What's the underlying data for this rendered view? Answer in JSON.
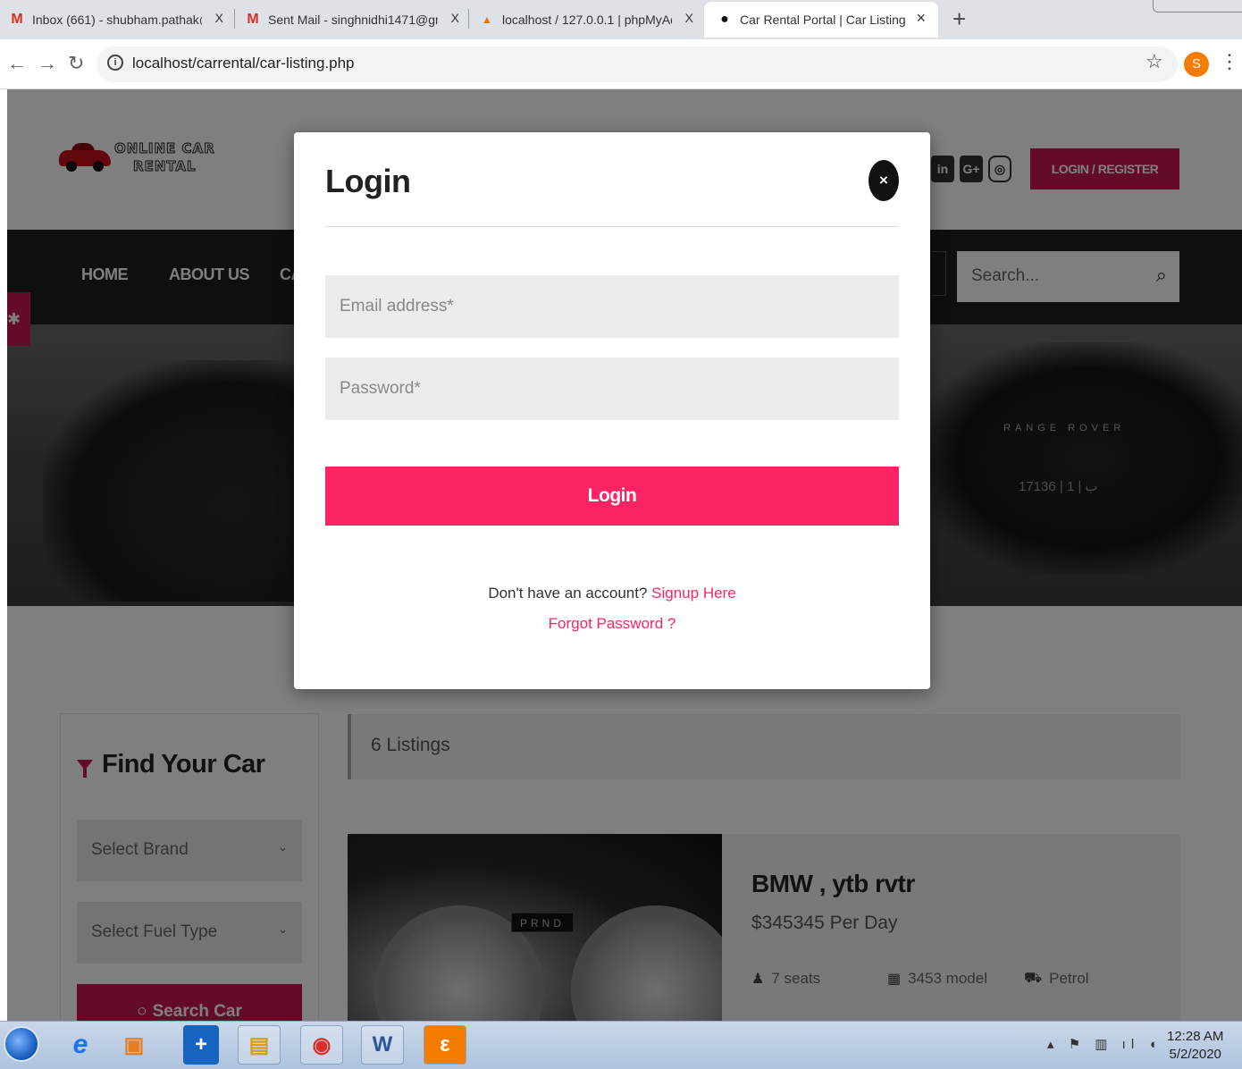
{
  "browser": {
    "tabs": [
      {
        "icon": "gmail-icon",
        "title": "Inbox (661) - shubham.pathak@t"
      },
      {
        "icon": "gmail-icon",
        "title": "Sent Mail - singhnidhi1471@gm"
      },
      {
        "icon": "phpmyadmin-icon",
        "title": "localhost / 127.0.0.1 | phpMyAdm"
      },
      {
        "icon": "site-icon",
        "title": "Car Rental Portal | Car Listing"
      }
    ],
    "close_glyph": "X",
    "active_close_glyph": "×",
    "new_tab_glyph": "+",
    "url": "localhost/carrental/car-listing.php",
    "profile_initial": "S"
  },
  "site": {
    "logo_line1": "ONLINE CAR",
    "logo_line2": "RENTAL",
    "social": [
      "in",
      "G+",
      "◎"
    ],
    "login_register": "LOGIN / REGISTER",
    "nav": [
      "HOME",
      "ABOUT US",
      "CA"
    ],
    "search_placeholder": "Search..."
  },
  "hero": {
    "badge_text": "RANGE ROVER",
    "plate_text": "17136 | ب | 1"
  },
  "sidebar": {
    "title": "Find Your Car",
    "brand_select": "Select Brand",
    "fuel_select": "Select Fuel Type",
    "search_button": "Search Car"
  },
  "listing": {
    "count_label": "6 Listings",
    "car": {
      "title": "BMW , ytb rvtr",
      "price": "$345345 Per Day",
      "seats": "7 seats",
      "model": "3453 model",
      "fuel": "Petrol",
      "gear_display": "PRND"
    }
  },
  "modal": {
    "title": "Login",
    "close_glyph": "×",
    "email_placeholder": "Email address*",
    "password_placeholder": "Password*",
    "submit_label": "Login",
    "signup_prompt": "Don't have an account?",
    "signup_link": "Signup Here",
    "forgot_link": "Forgot Password ?"
  },
  "taskbar": {
    "time": "12:28 AM",
    "date": "5/2/2020"
  },
  "colors": {
    "accent": "#fb2463",
    "brand_red": "#c8184e",
    "navbar": "#1e1e1e"
  }
}
